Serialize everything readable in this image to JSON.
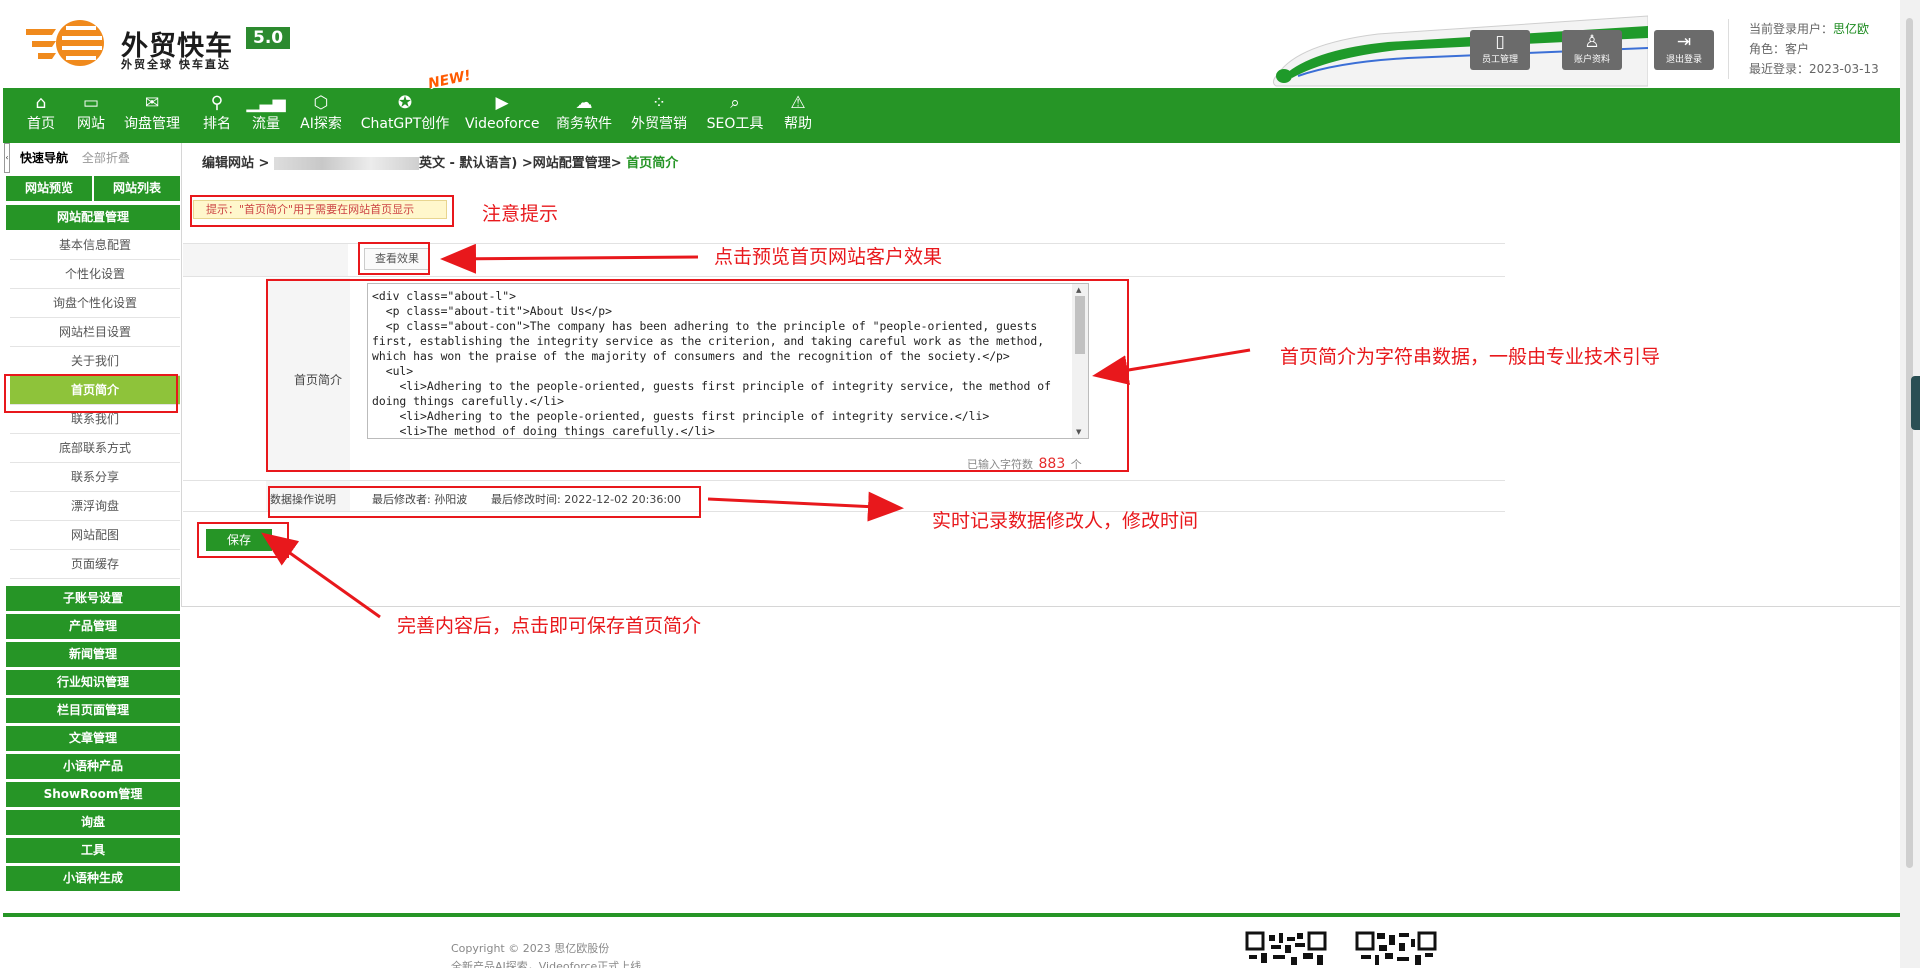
{
  "brand": {
    "title": "外贸快车",
    "version": "5.0",
    "slogan": "外贸全球 快车直达"
  },
  "header_buttons": [
    {
      "label": "员工管理",
      "icon": "staff-icon"
    },
    {
      "label": "账户资料",
      "icon": "account-icon"
    },
    {
      "label": "退出登录",
      "icon": "logout-icon"
    }
  ],
  "user": {
    "current_label": "当前登录用户：",
    "name": "思亿欧",
    "role": "角色：客户",
    "last_login": "最近登录：2023-03-13"
  },
  "nav": [
    {
      "label": "首页",
      "icon": "home-icon"
    },
    {
      "label": "网站",
      "icon": "monitor-icon"
    },
    {
      "label": "询盘管理",
      "icon": "mail-icon"
    },
    {
      "label": "排名",
      "icon": "ranking-icon"
    },
    {
      "label": "流量",
      "icon": "bar-chart-icon"
    },
    {
      "label": "AI探索",
      "icon": "ai-icon"
    },
    {
      "label": "ChatGPT创作",
      "icon": "chatgpt-icon"
    },
    {
      "label": "Videoforce",
      "icon": "play-icon"
    },
    {
      "label": "商务软件",
      "icon": "software-icon"
    },
    {
      "label": "外贸营销",
      "icon": "marketing-icon"
    },
    {
      "label": "SEO工具",
      "icon": "search-icon"
    },
    {
      "label": "帮助",
      "icon": "help-icon"
    }
  ],
  "new_badge": "NEW!",
  "sidebar": {
    "quick_nav": "快速导航",
    "collapse_all": "全部折叠",
    "preview_btn": "网站预览",
    "list_btn": "网站列表",
    "config_group": "网站配置管理",
    "items": [
      "基本信息配置",
      "个性化设置",
      "询盘个性化设置",
      "网站栏目设置",
      "关于我们",
      "首页简介",
      "联系我们",
      "底部联系方式",
      "联系分享",
      "漂浮询盘",
      "网站配图",
      "页面缓存"
    ],
    "active_index": 5,
    "groups": [
      "子账号设置",
      "产品管理",
      "新闻管理",
      "行业知识管理",
      "栏目页面管理",
      "文章管理",
      "小语种产品",
      "ShowRoom管理",
      "询盘",
      "工具",
      "小语种生成"
    ]
  },
  "breadcrumb": {
    "prefix": "编辑网站 >",
    "lang": "英文 - 默认语言) >网站配置管理>",
    "current": "首页简介"
  },
  "tip": "提示：\"首页简介\"用于需要在网站首页显示",
  "view_effect": "查看效果",
  "intro_label": "首页简介",
  "intro_content": "<div class=\"about-l\">\n  <p class=\"about-tit\">About Us</p>\n  <p class=\"about-con\">The company has been adhering to the principle of \"people-oriented, guests first, establishing the integrity service as the criterion, and taking careful work as the method, which has won the praise of the majority of consumers and the recognition of the society.</p>\n  <ul>\n    <li>Adhering to the people-oriented, guests first principle of integrity service, the method of doing things carefully.</li>\n    <li>Adhering to the people-oriented, guests first principle of integrity service.</li>\n    <li>The method of doing things carefully.</li>\n  </ul>\n</div>",
  "char_count": {
    "prefix": "已输入字符数",
    "value": "883",
    "suffix": "个"
  },
  "meta": {
    "label": "数据操作说明",
    "modifier": "最后修改者: 孙阳波",
    "modified_time": "最后修改时间: 2022-12-02 20:36:00"
  },
  "save": "保存",
  "annotations": {
    "tip": "注意提示",
    "preview": "点击预览首页网站客户效果",
    "intro": "首页简介为字符串数据，一般由专业技术引导",
    "record": "实时记录数据修改人，修改时间",
    "save": "完善内容后，点击即可保存首页简介"
  },
  "footer": {
    "copyright": "Copyright © 2023 思亿欧股份",
    "news": "全新产品AI探索，Videoforce正式上线"
  },
  "colors": {
    "brand_green": "#269526",
    "active_green": "#8ec33a",
    "annotation_red": "#e8181c",
    "logo_orange": "#f08a1d"
  }
}
